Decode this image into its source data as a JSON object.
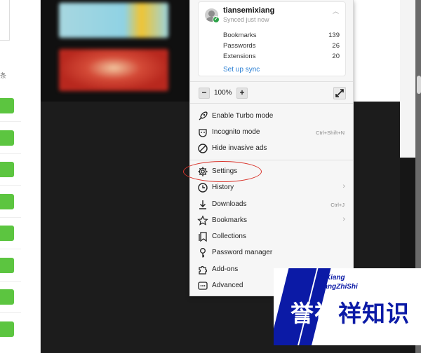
{
  "profile": {
    "username": "tiansemixiang",
    "sync_status": "Synced just now",
    "stats": [
      {
        "label": "Bookmarks",
        "count": "139"
      },
      {
        "label": "Passwords",
        "count": "26"
      },
      {
        "label": "Extensions",
        "count": "20"
      }
    ],
    "setup_sync_label": "Set up sync"
  },
  "zoom": {
    "minus_label": "−",
    "value": "100%",
    "plus_label": "+"
  },
  "menu_items": [
    {
      "label": "Enable Turbo mode",
      "icon": "rocket-icon"
    },
    {
      "label": "Incognito mode",
      "icon": "incognito-icon",
      "shortcut": "Ctrl+Shift+N"
    },
    {
      "label": "Hide invasive ads",
      "icon": "block-icon"
    },
    {
      "label": "Settings",
      "icon": "gear-icon"
    },
    {
      "label": "History",
      "icon": "clock-icon",
      "has_submenu": true
    },
    {
      "label": "Downloads",
      "icon": "download-icon",
      "shortcut": "Ctrl+J"
    },
    {
      "label": "Bookmarks",
      "icon": "star-icon",
      "has_submenu": true
    },
    {
      "label": "Collections",
      "icon": "collections-icon"
    },
    {
      "label": "Password manager",
      "icon": "key-icon"
    },
    {
      "label": "Add-ons",
      "icon": "puzzle-icon"
    },
    {
      "label": "Advanced",
      "icon": "more-icon"
    }
  ],
  "highlight": {
    "target": "Settings",
    "color": "#d9342b"
  },
  "left_strip": {
    "glyph": "条"
  },
  "watermark": {
    "line1": "YuXiang",
    "line2": "XiangZhiShi",
    "cn_a": "誉祥",
    "cn_b": "祥知识"
  },
  "colors": {
    "accent_link": "#2a7fd4",
    "sync_ok": "#2da248",
    "left_buttons": "#5cc540",
    "watermark_blue": "#0b1aa6"
  }
}
